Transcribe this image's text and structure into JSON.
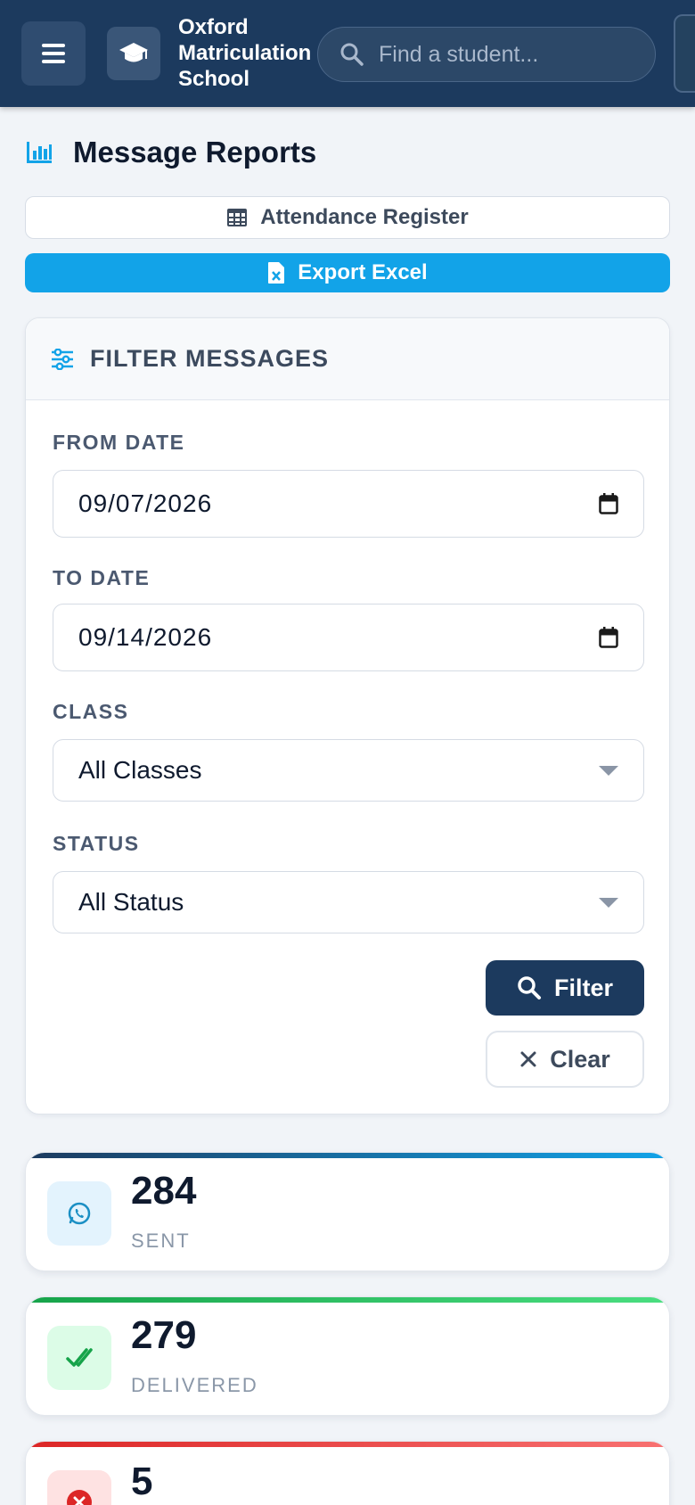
{
  "header": {
    "school_name": "Oxford Matriculation School",
    "search_placeholder": "Find a student..."
  },
  "page": {
    "title": "Message Reports"
  },
  "actions": {
    "attendance_label": "Attendance Register",
    "export_label": "Export Excel"
  },
  "filter": {
    "title": "FILTER MESSAGES",
    "from_label": "FROM DATE",
    "from_value": "09/07/2026",
    "to_label": "TO DATE",
    "to_value": "09/14/2026",
    "class_label": "CLASS",
    "class_value": "All Classes",
    "status_label": "STATUS",
    "status_value": "All Status",
    "filter_button": "Filter",
    "clear_button": "Clear"
  },
  "stats": [
    {
      "value": "284",
      "label": "SENT",
      "icon": "whatsapp-icon",
      "accent": "#1c3a5e",
      "accent2": "#12a3e8",
      "icon_bg": "#e3f3fd",
      "icon_color": "#1b8fc4"
    },
    {
      "value": "279",
      "label": "DELIVERED",
      "icon": "check-double-icon",
      "accent": "#16a34a",
      "accent2": "#4ade80",
      "icon_bg": "#dcfce7",
      "icon_color": "#16a34a"
    },
    {
      "value": "5",
      "label": "",
      "icon": "error-icon",
      "accent": "#dc2626",
      "accent2": "#f87171",
      "icon_bg": "#fee2e2",
      "icon_color": "#dc2626"
    }
  ],
  "colors": {
    "primary": "#1c3a5e",
    "accent": "#12a3e8"
  }
}
